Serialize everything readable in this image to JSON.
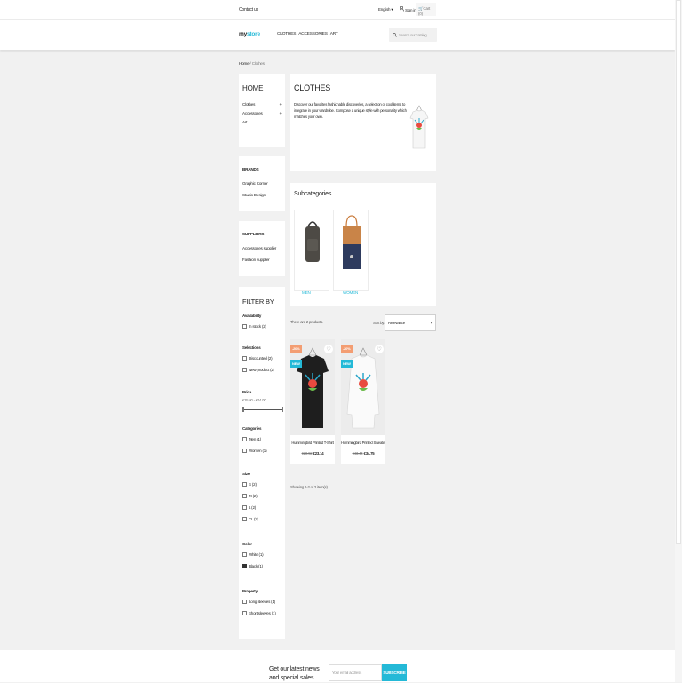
{
  "topbar": {
    "contact": "Contact us",
    "language": "English",
    "signin": "Sign in",
    "cart": "Cart (0)"
  },
  "header": {
    "logo_left": "my",
    "logo_right": "store",
    "nav": [
      "CLOTHES",
      "ACCESSORIES",
      "ART"
    ],
    "search_placeholder": "Search our catalog"
  },
  "breadcrumb": {
    "home": "Home",
    "sep": "/",
    "current": "Clothes"
  },
  "sidebar": {
    "home_title": "HOME",
    "categories": [
      {
        "label": "Clothes",
        "toggle": "+"
      },
      {
        "label": "Accessories",
        "toggle": "+"
      },
      {
        "label": "Art",
        "toggle": ""
      }
    ],
    "brands_title": "BRANDS",
    "brands": [
      "Graphic Corner",
      "Studio Design"
    ],
    "suppliers_title": "SUPPLIERS",
    "suppliers": [
      "Accessories supplier",
      "Fashion supplier"
    ],
    "filter_title": "FILTER BY",
    "availability": {
      "title": "Availability",
      "items": [
        "In stock (2)"
      ]
    },
    "selections": {
      "title": "Selections",
      "items": [
        "Discounted (2)",
        "New product (2)"
      ]
    },
    "price": {
      "title": "Price",
      "range": "€35.00 - €44.00"
    },
    "categories_filter": {
      "title": "Categories",
      "items": [
        "Men (1)",
        "Women (1)"
      ]
    },
    "size": {
      "title": "Size",
      "items": [
        "S (2)",
        "M (2)",
        "L (2)",
        "XL (2)"
      ]
    },
    "color": {
      "title": "Color",
      "items": [
        "White (1)",
        "Black (1)"
      ]
    },
    "property": {
      "title": "Property",
      "items": [
        "Long sleeves (1)",
        "Short sleeves (1)"
      ]
    }
  },
  "category": {
    "title": "CLOTHES",
    "description": "Discover our favorites fashionable discoveries, a selection of cool items to integrate in your wardrobe. Compose a unique style with personality which matches your own."
  },
  "subcategories": {
    "title": "Subcategories",
    "items": [
      "MEN",
      "WOMEN"
    ]
  },
  "listing": {
    "count_text": "There are 2 products.",
    "sort_label": "Sort by:",
    "sort_value": "Relevance",
    "showing": "Showing 1-2 of 2 item(s)"
  },
  "products": [
    {
      "name": "Hummingbird Printed T-Shirt",
      "old_price": "€28.92",
      "price": "€23.14",
      "discount": "-20%",
      "new_flag": "NEW"
    },
    {
      "name": "Hummingbird Printed Sweater",
      "old_price": "€43.44",
      "price": "€34.75",
      "discount": "-20%",
      "new_flag": "NEW"
    }
  ],
  "newsletter": {
    "title": "Get our latest news and special sales",
    "placeholder": "Your email address",
    "button": "SUBSCRIBE"
  },
  "colors": {
    "accent": "#24b9d7",
    "discount": "#f39d72",
    "background": "#f1f1f1"
  }
}
